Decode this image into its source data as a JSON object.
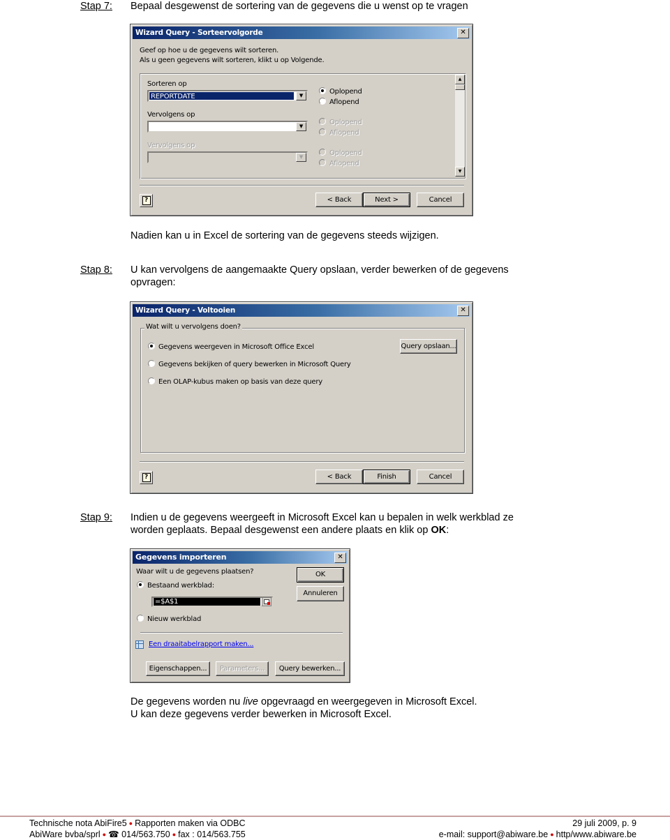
{
  "steps": {
    "step7": {
      "label": "Stap 7:",
      "text": "Bepaal desgewenst de sortering van de gegevens die u wenst op te vragen"
    },
    "step7_note": "Nadien kan u in Excel de sortering van de gegevens steeds wijzigen.",
    "step8": {
      "label": "Stap 8:",
      "text_line1": "U kan vervolgens de aangemaakte Query opslaan, verder bewerken of de gegevens",
      "text_line2": "opvragen:"
    },
    "step9": {
      "label": "Stap 9:",
      "text_line1": "Indien u de gegevens weergeeft in Microsoft Excel kan u bepalen in welk werkblad ze",
      "text_line2_prefix": "worden geplaats. Bepaal desgewenst een andere plaats en klik op ",
      "text_line2_bold": "OK",
      "text_line2_suffix": ":"
    },
    "closing_line1_prefix": "De gegevens worden nu ",
    "closing_line1_italic": "live",
    "closing_line1_suffix": " opgevraagd en weergegeven in Microsoft Excel.",
    "closing_line2": "U kan deze gegevens verder bewerken in Microsoft Excel."
  },
  "dialog_sort": {
    "title": "Wizard Query - Sorteervolgorde",
    "close": "✕",
    "intro_line1": "Geef op hoe u de gegevens wilt sorteren.",
    "intro_line2": "Als u geen gegevens wilt sorteren, klikt u op Volgende.",
    "sort1": {
      "label": "Sorteren op",
      "value": "REPORTDATE",
      "asc": "Oplopend",
      "desc": "Aflopend",
      "selected": "asc"
    },
    "sort2": {
      "label": "Vervolgens op",
      "value": "",
      "asc": "Oplopend",
      "desc": "Aflopend"
    },
    "sort3": {
      "label": "Vervolgens op",
      "value": "",
      "asc": "Oplopend",
      "desc": "Aflopend"
    },
    "help": "?",
    "buttons": {
      "back": "< Back",
      "next": "Next >",
      "cancel": "Cancel"
    }
  },
  "dialog_finish": {
    "title": "Wizard Query - Voltooien",
    "close": "✕",
    "group_label": "Wat wilt u vervolgens doen?",
    "options": [
      {
        "label": "Gegevens weergeven in Microsoft Office Excel",
        "selected": true
      },
      {
        "label": "Gegevens bekijken of query bewerken in Microsoft Query",
        "selected": false
      },
      {
        "label": "Een OLAP-kubus maken op basis van deze query",
        "selected": false
      }
    ],
    "save_query": "Query opslaan...",
    "help": "?",
    "buttons": {
      "back": "< Back",
      "finish": "Finish",
      "cancel": "Cancel"
    }
  },
  "dialog_import": {
    "title": "Gegevens importeren",
    "close": "✕",
    "question": "Waar wilt u de gegevens plaatsen?",
    "existing_sheet": "Bestaand werkblad:",
    "existing_selected": true,
    "cell_ref": "=$A$1",
    "new_sheet": "Nieuw werkblad",
    "pivot_link": "Een draaitabelrapport maken...",
    "buttons": {
      "ok": "OK",
      "cancel": "Annuleren",
      "properties": "Eigenschappen...",
      "parameters": "Parameters...",
      "edit_query": "Query bewerken..."
    }
  },
  "footer": {
    "left_line1_a": "Technische nota AbiFire5",
    "left_line1_b": "Rapporten maken via ODBC",
    "left_line2_a": "AbiWare bvba/sprl",
    "phone_icon": "☎",
    "left_line2_b": "014/563.750",
    "left_line2_c": "fax : 014/563.755",
    "right_line1": "29 juli 2009, p. 9",
    "right_line2_a": "e-mail: support@abiware.be",
    "right_line2_b": "http/www.abiware.be",
    "bullet": "●"
  }
}
